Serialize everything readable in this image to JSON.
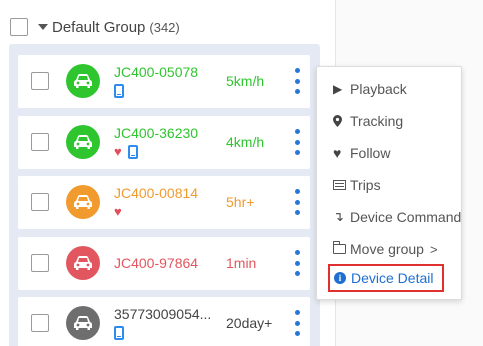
{
  "group": {
    "name": "Default Group",
    "count": "(342)"
  },
  "devices": [
    {
      "name": "JC400-05078",
      "speed": "5km/h",
      "status_color": "#2fc52f",
      "icons": [
        "phone-icon"
      ]
    },
    {
      "name": "JC400-36230",
      "speed": "4km/h",
      "status_color": "#2fc52f",
      "icons": [
        "heart-icon",
        "phone-icon"
      ]
    },
    {
      "name": "JC400-00814",
      "speed": "5hr+",
      "status_color": "#f19a2e",
      "icons": [
        "heart-icon"
      ]
    },
    {
      "name": "JC400-97864",
      "speed": "1min",
      "status_color": "#e2565f",
      "icons": []
    },
    {
      "name": "35773009054...",
      "speed": "20day+",
      "status_color": "#6e6e6e",
      "icons": [
        "phone-icon"
      ]
    }
  ],
  "menu": {
    "playback": "Playback",
    "tracking": "Tracking",
    "follow": "Follow",
    "trips": "Trips",
    "device_command": "Device Command",
    "move_group": "Move group",
    "move_group_arrow": ">",
    "device_detail": "Device Detail"
  },
  "colors": {
    "online": "#2fc52f",
    "idle": "#f19a2e",
    "alarm": "#e2565f",
    "offline": "#6e6e6e",
    "accent": "#2677d9",
    "highlight_border": "#e0302e"
  }
}
